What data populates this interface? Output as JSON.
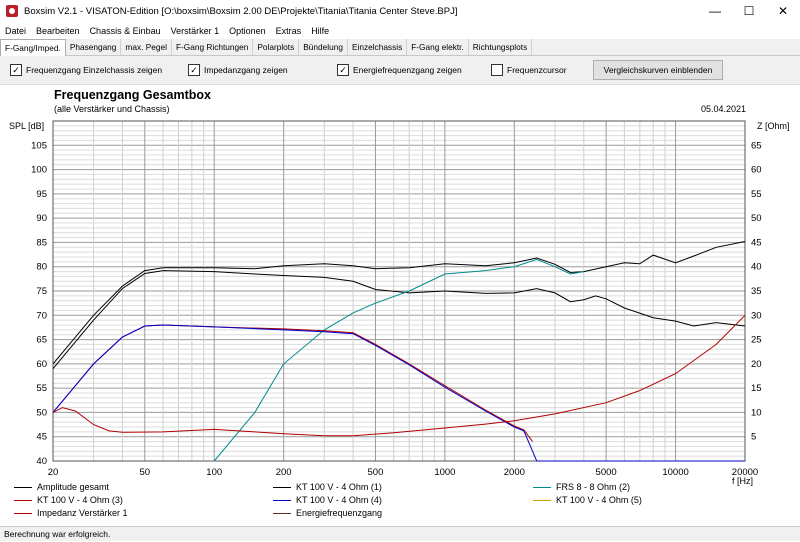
{
  "window": {
    "title": "Boxsim V2.1 - VISATON-Edition [O:\\boxsim\\Boxsim 2.00 DE\\Projekte\\Titania\\Titania Center Steve.BPJ]",
    "minimize": "—",
    "maximize": "☐",
    "close": "✕"
  },
  "menu": [
    "Datei",
    "Bearbeiten",
    "Chassis & Einbau",
    "Verstärker 1",
    "Optionen",
    "Extras",
    "Hilfe"
  ],
  "tabs": [
    "F-Gang/Imped.",
    "Phasengang",
    "max. Pegel",
    "F-Gang Richtungen",
    "Polarplots",
    "Bündelung",
    "Einzelchassis",
    "F-Gang elektr.",
    "Richtungsplots"
  ],
  "options": {
    "chk1": {
      "label": "Frequenzgang Einzelchassis zeigen",
      "checked": "✓"
    },
    "chk2": {
      "label": "Impedanzgang zeigen",
      "checked": "✓"
    },
    "chk3": {
      "label": "Energiefrequenzgang zeigen",
      "checked": "✓"
    },
    "chk4": {
      "label": "Frequenzcursor",
      "checked": ""
    },
    "compare_button": "Vergleichskurven einblenden"
  },
  "plot": {
    "title": "Frequenzgang Gesamtbox",
    "subtitle": "(alle Verstärker und Chassis)",
    "date": "05.04.2021",
    "y_left_label": "SPL [dB]",
    "y_right_label": "Z [Ohm]",
    "x_label": "f [Hz]"
  },
  "status": "Berechnung war erfolgreich.",
  "chart_data": {
    "type": "line",
    "x_scale": "log",
    "xlim": [
      20,
      20000
    ],
    "ylim_left": [
      40,
      110
    ],
    "ylim_right": [
      0,
      70
    ],
    "x_ticks": [
      20,
      50,
      100,
      200,
      500,
      1000,
      2000,
      5000,
      10000,
      20000
    ],
    "x_tick_labels": [
      "20",
      "50",
      "100",
      "200",
      "500",
      "1000",
      "2000",
      "5000",
      "10000",
      "20000"
    ],
    "y_left_ticks": [
      40,
      45,
      50,
      55,
      60,
      65,
      70,
      75,
      80,
      85,
      90,
      95,
      100,
      105
    ],
    "y_right_ticks": [
      5,
      10,
      15,
      20,
      25,
      30,
      35,
      40,
      45,
      50,
      55,
      60,
      65
    ],
    "grid": true,
    "series": [
      {
        "name": "Amplitude gesamt",
        "axis": "left",
        "color": "#000000",
        "points": [
          [
            20,
            60
          ],
          [
            30,
            70
          ],
          [
            40,
            76
          ],
          [
            50,
            79.2
          ],
          [
            60,
            79.8
          ],
          [
            100,
            79.8
          ],
          [
            150,
            79.6
          ],
          [
            200,
            80.2
          ],
          [
            300,
            80.6
          ],
          [
            400,
            80.2
          ],
          [
            500,
            79.6
          ],
          [
            700,
            79.8
          ],
          [
            1000,
            80.6
          ],
          [
            1500,
            80.2
          ],
          [
            2000,
            80.8
          ],
          [
            2500,
            81.8
          ],
          [
            3000,
            80.5
          ],
          [
            3500,
            78.8
          ],
          [
            4000,
            79
          ],
          [
            5000,
            80
          ],
          [
            6000,
            80.8
          ],
          [
            7000,
            80.6
          ],
          [
            8000,
            82.4
          ],
          [
            10000,
            80.8
          ],
          [
            12000,
            82.2
          ],
          [
            15000,
            84
          ],
          [
            20000,
            85.2
          ]
        ]
      },
      {
        "name": "KT 100 V - 4 Ohm (1)",
        "axis": "left",
        "color": "#000000",
        "points": [
          [
            20,
            59
          ],
          [
            30,
            69
          ],
          [
            40,
            75.5
          ],
          [
            50,
            78.6
          ],
          [
            60,
            79.2
          ],
          [
            100,
            79
          ],
          [
            150,
            78.5
          ],
          [
            200,
            78.2
          ],
          [
            300,
            77.8
          ],
          [
            400,
            77
          ],
          [
            500,
            75.3
          ],
          [
            700,
            74.6
          ],
          [
            1000,
            75
          ],
          [
            1500,
            74.5
          ],
          [
            2000,
            74.6
          ],
          [
            2500,
            75.5
          ],
          [
            3000,
            74.6
          ],
          [
            3500,
            72.8
          ],
          [
            4000,
            73.2
          ],
          [
            4500,
            74
          ],
          [
            5000,
            73.4
          ],
          [
            6000,
            71.5
          ],
          [
            8000,
            69.5
          ],
          [
            10000,
            68.8
          ],
          [
            12000,
            67.8
          ],
          [
            15000,
            68.5
          ],
          [
            20000,
            67.8
          ]
        ]
      },
      {
        "name": "FRS 8 - 8 Ohm (2)",
        "axis": "left",
        "color": "#008b8b",
        "points": [
          [
            100,
            40
          ],
          [
            150,
            50
          ],
          [
            200,
            60
          ],
          [
            300,
            67
          ],
          [
            400,
            70.5
          ],
          [
            500,
            72.5
          ],
          [
            700,
            75
          ],
          [
            1000,
            78.5
          ],
          [
            1500,
            79.2
          ],
          [
            2000,
            80
          ],
          [
            2500,
            81.5
          ],
          [
            3000,
            80
          ],
          [
            3500,
            78.5
          ],
          [
            4000,
            79
          ]
        ]
      },
      {
        "name": "KT 100 V - 4 Ohm (3)",
        "axis": "left",
        "color": "#b00000",
        "points": [
          [
            20,
            50
          ],
          [
            30,
            60
          ],
          [
            40,
            65.5
          ],
          [
            50,
            67.8
          ],
          [
            60,
            68
          ],
          [
            100,
            67.6
          ],
          [
            200,
            67.2
          ],
          [
            300,
            66.8
          ],
          [
            400,
            66.4
          ],
          [
            500,
            64
          ],
          [
            700,
            60
          ],
          [
            1000,
            55.5
          ],
          [
            1500,
            50.5
          ],
          [
            2000,
            47.2
          ],
          [
            2200,
            46.4
          ],
          [
            2400,
            44
          ]
        ]
      },
      {
        "name": "KT 100 V - 4 Ohm (4)",
        "axis": "left",
        "color": "#0000cc",
        "points": [
          [
            20,
            50
          ],
          [
            30,
            60
          ],
          [
            40,
            65.5
          ],
          [
            50,
            67.8
          ],
          [
            60,
            68
          ],
          [
            100,
            67.6
          ],
          [
            200,
            67
          ],
          [
            300,
            66.6
          ],
          [
            400,
            66.2
          ],
          [
            500,
            63.8
          ],
          [
            700,
            59.8
          ],
          [
            1000,
            55.2
          ],
          [
            1500,
            50.3
          ],
          [
            2000,
            47
          ],
          [
            2200,
            46.2
          ],
          [
            2400,
            42
          ],
          [
            2500,
            40
          ],
          [
            20000,
            40
          ]
        ]
      },
      {
        "name": "KT 100 V - 4 Ohm (5)",
        "axis": "left",
        "color": "#d4a000",
        "points": []
      },
      {
        "name": "Impedanz Verstärker 1",
        "axis": "right",
        "color": "#b00000",
        "points": [
          [
            20,
            10
          ],
          [
            22,
            11
          ],
          [
            25,
            10.3
          ],
          [
            30,
            7.5
          ],
          [
            35,
            6.2
          ],
          [
            40,
            5.9
          ],
          [
            60,
            6
          ],
          [
            100,
            6.5
          ],
          [
            150,
            6
          ],
          [
            200,
            5.6
          ],
          [
            300,
            5.2
          ],
          [
            400,
            5.2
          ],
          [
            600,
            5.8
          ],
          [
            1000,
            6.8
          ],
          [
            1500,
            7.6
          ],
          [
            2000,
            8.3
          ],
          [
            3000,
            9.7
          ],
          [
            5000,
            12
          ],
          [
            7000,
            14.5
          ],
          [
            10000,
            18
          ],
          [
            15000,
            24
          ],
          [
            20000,
            30
          ]
        ]
      },
      {
        "name": "Energiefrequenzgang",
        "axis": "left",
        "color": "#6a2a2a",
        "points": []
      }
    ]
  }
}
